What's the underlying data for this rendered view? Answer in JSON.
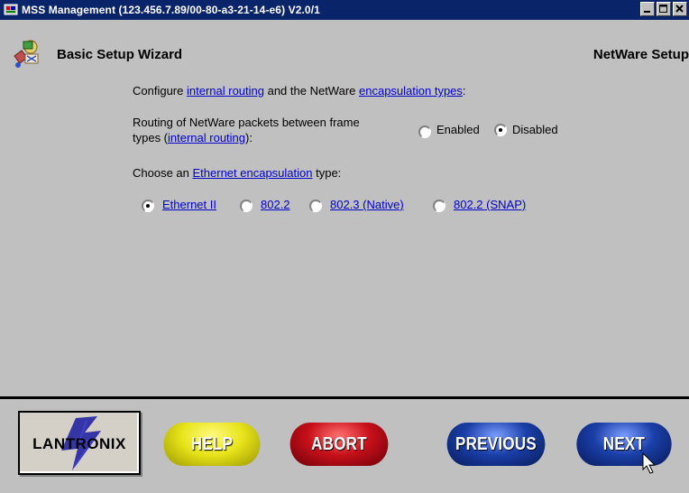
{
  "window": {
    "title": "MSS Management (123.456.7.89/00-80-a3-21-14-e6) V2.0/1",
    "controls": [
      "minimize-icon",
      "maximize-icon",
      "close-icon"
    ]
  },
  "header": {
    "title": "Basic Setup Wizard",
    "section": "NetWare Setup"
  },
  "intro": {
    "prefix": "Configure ",
    "link1": "internal routing",
    "middle": " and the NetWare ",
    "link2": "encapsulation types",
    "suffix": ":"
  },
  "routing": {
    "line1": "Routing of NetWare packets between frame",
    "line2_prefix": "types (",
    "line2_link": "internal routing",
    "line2_suffix": "):",
    "options": [
      {
        "label": "Enabled",
        "checked": false
      },
      {
        "label": "Disabled",
        "checked": true
      }
    ]
  },
  "encapsulation": {
    "prompt_prefix": "Choose an ",
    "prompt_link": "Ethernet encapsulation",
    "prompt_suffix": " type:",
    "options": [
      {
        "label": "Ethernet II",
        "checked": true
      },
      {
        "label": "802.2",
        "checked": false
      },
      {
        "label": "802.3 (Native)",
        "checked": false
      },
      {
        "label": "802.2 (SNAP)",
        "checked": false
      }
    ]
  },
  "footer": {
    "logo_text": "LANTRONIX",
    "buttons": {
      "help": "HELP",
      "abort": "ABORT",
      "previous": "PREVIOUS",
      "next": "NEXT"
    }
  },
  "colors": {
    "titlebar": "#0a246a",
    "link": "#0000cc",
    "help": "#e8e41a",
    "abort": "#c8101a",
    "nav": "#1a3fa8"
  }
}
